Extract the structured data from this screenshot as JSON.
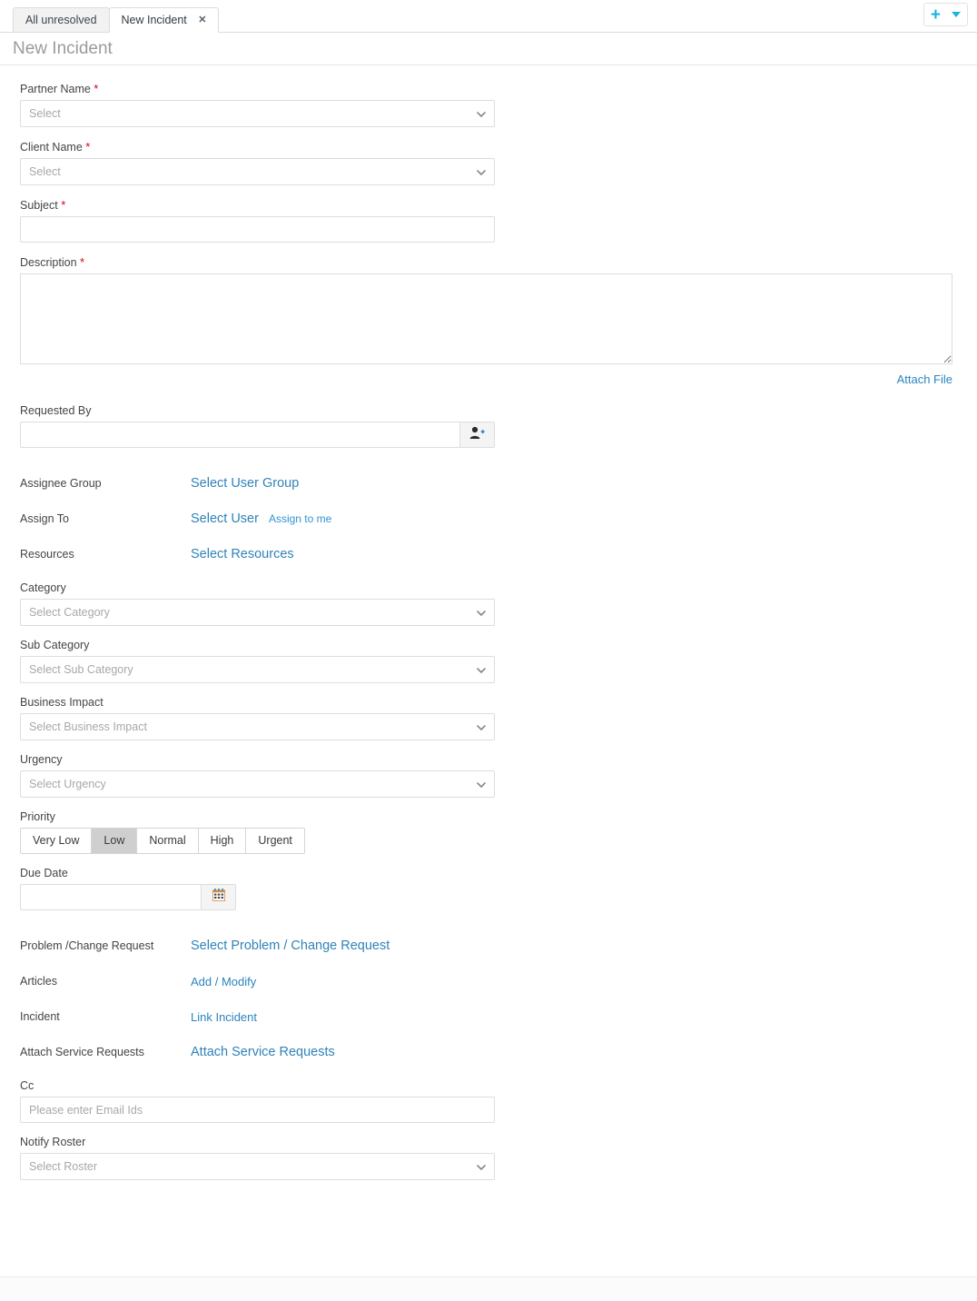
{
  "tabs": {
    "items": [
      {
        "label": "All unresolved",
        "active": false,
        "closable": false
      },
      {
        "label": "New Incident",
        "active": true,
        "closable": true,
        "close_glyph": "✕"
      }
    ],
    "actions": {
      "add_label": "+",
      "dropdown_label": "▾",
      "accent_color": "#1bb3e0"
    }
  },
  "header": {
    "title": "New Incident"
  },
  "form": {
    "partner_name": {
      "label": "Partner Name",
      "required": true,
      "value": "Select",
      "placeholder": "Select"
    },
    "client_name": {
      "label": "Client Name",
      "required": true,
      "value": "Select",
      "placeholder": "Select"
    },
    "subject": {
      "label": "Subject",
      "required": true,
      "value": "",
      "placeholder": ""
    },
    "description": {
      "label": "Description",
      "required": true,
      "value": "",
      "placeholder": ""
    },
    "attach_file": {
      "label": "Attach File"
    },
    "requested_by": {
      "label": "Requested By",
      "value": "",
      "placeholder": "",
      "button_icon": "add-user-icon"
    },
    "assignee_group": {
      "label": "Assignee Group",
      "link": "Select User Group"
    },
    "assign_to": {
      "label": "Assign To",
      "link": "Select User",
      "secondary_link": "Assign to me"
    },
    "resources": {
      "label": "Resources",
      "link": "Select Resources"
    },
    "category": {
      "label": "Category",
      "value": "Select Category",
      "placeholder": "Select Category"
    },
    "sub_category": {
      "label": "Sub Category",
      "value": "Select Sub Category",
      "placeholder": "Select Sub Category"
    },
    "business_impact": {
      "label": "Business Impact",
      "value": "Select Business Impact",
      "placeholder": "Select Business Impact"
    },
    "urgency": {
      "label": "Urgency",
      "value": "Select Urgency",
      "placeholder": "Select Urgency"
    },
    "priority": {
      "label": "Priority",
      "options": [
        "Very Low",
        "Low",
        "Normal",
        "High",
        "Urgent"
      ],
      "selected": "Low"
    },
    "due_date": {
      "label": "Due Date",
      "value": "",
      "placeholder": "",
      "button_icon": "calendar-icon"
    },
    "problem_change_request": {
      "label": "Problem /Change Request",
      "link": "Select Problem / Change Request"
    },
    "articles": {
      "label": "Articles",
      "link": "Add / Modify"
    },
    "incident": {
      "label": "Incident",
      "link": "Link Incident"
    },
    "attach_service_requests": {
      "label": "Attach Service Requests",
      "link": "Attach Service Requests"
    },
    "cc": {
      "label": "Cc",
      "value": "",
      "placeholder": "Please enter Email Ids"
    },
    "notify_roster": {
      "label": "Notify Roster",
      "value": "Select Roster",
      "placeholder": "Select Roster"
    }
  },
  "colors": {
    "link": "#2a85bd",
    "required": "#d0021b",
    "accent": "#1bb3e0",
    "selected_segment": "#cfcfcf"
  }
}
